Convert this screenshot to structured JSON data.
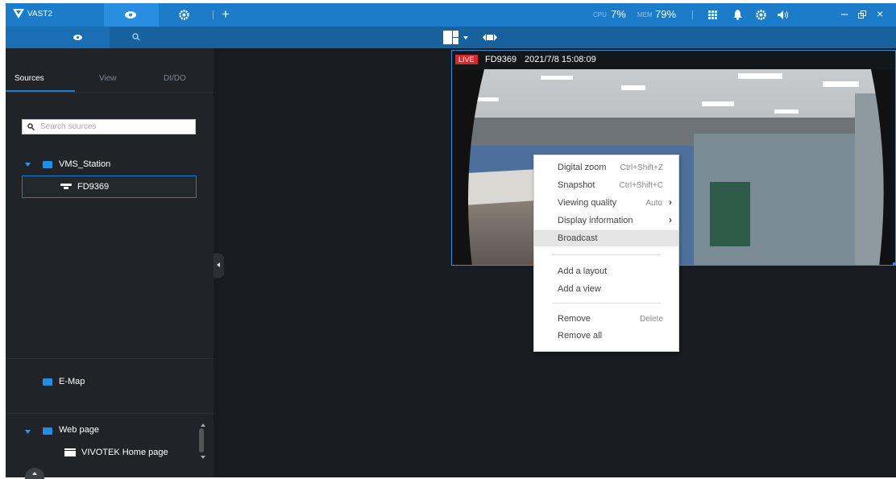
{
  "app": {
    "title": "VAST2"
  },
  "system": {
    "cpu_label": "CPU",
    "cpu_value": "7%",
    "mem_label": "MEM",
    "mem_value": "79%"
  },
  "sidebar": {
    "tabs": [
      "Sources",
      "View",
      "DI/DO"
    ],
    "search_placeholder": "Search sources",
    "station": "VMS_Station",
    "camera": "FD9369",
    "emap": "E-Map",
    "webpage": "Web page",
    "homepage": "VIVOTEK Home page"
  },
  "video": {
    "live": "LIVE",
    "camera": "FD9369",
    "timestamp": "2021/7/8 15:08:09"
  },
  "context_menu": {
    "digital_zoom": "Digital zoom",
    "digital_zoom_sc": "Ctrl+Shift+Z",
    "snapshot": "Snapshot",
    "snapshot_sc": "Ctrl+Shift+C",
    "viewing_quality": "Viewing quality",
    "viewing_quality_val": "Auto",
    "display_info": "Display information",
    "broadcast": "Broadcast",
    "add_layout": "Add a layout",
    "add_view": "Add a view",
    "remove": "Remove",
    "remove_sc": "Delete",
    "remove_all": "Remove all"
  },
  "colors": {
    "accent": "#1c7cc9",
    "live": "#d9282d",
    "sidebar": "#202429",
    "main": "#181b1f"
  }
}
